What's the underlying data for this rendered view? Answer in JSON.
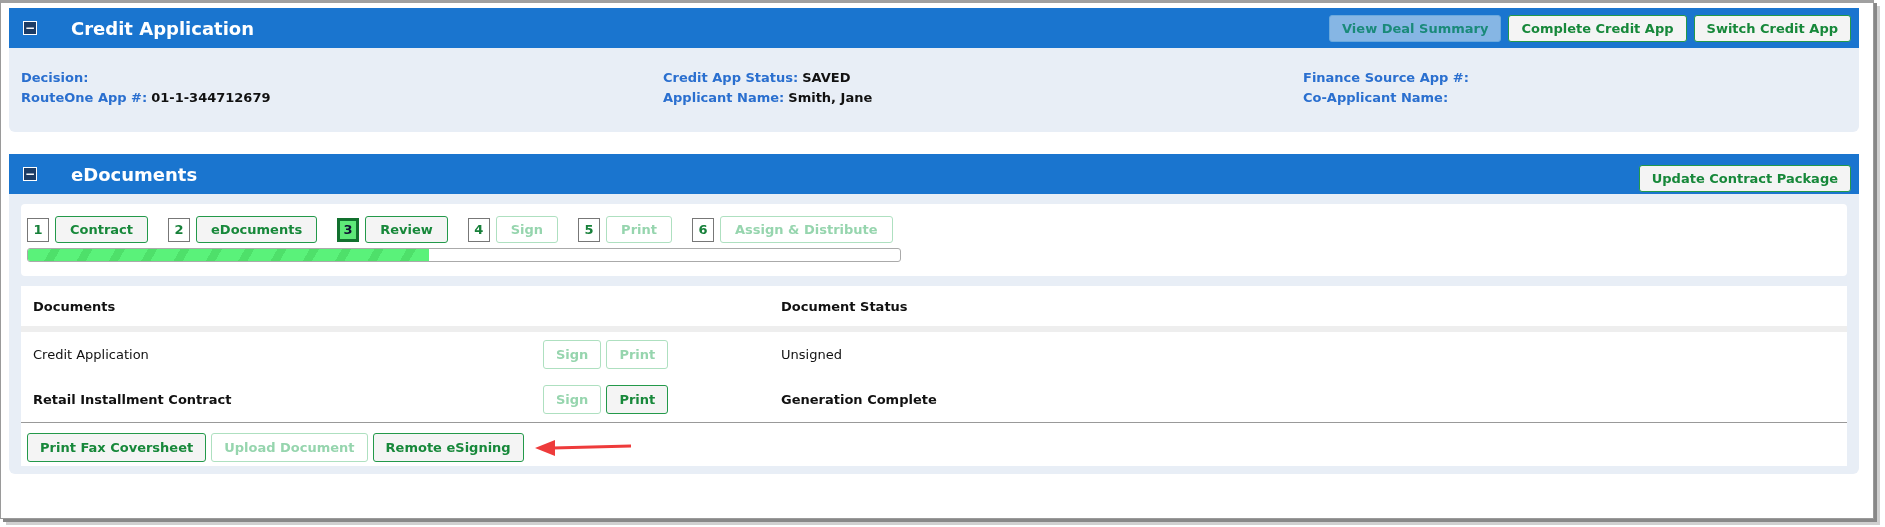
{
  "credit_panel": {
    "title": "Credit Application",
    "collapse_icon": "−",
    "buttons": [
      {
        "label": "View Deal Summary",
        "kind": "secondary"
      },
      {
        "label": "Complete Credit App",
        "kind": "primary"
      },
      {
        "label": "Switch Credit App",
        "kind": "primary"
      }
    ],
    "columns": [
      [
        {
          "label": "Decision:"
        },
        {
          "label": "RouteOne App #:",
          "value": "01-1-344712679"
        }
      ],
      [
        {
          "label": "Credit App Status:",
          "value": "SAVED"
        },
        {
          "label": "Applicant Name:",
          "value": "Smith, Jane"
        }
      ],
      [
        {
          "label": "Finance Source App #:"
        },
        {
          "label": "Co-Applicant Name:"
        }
      ]
    ]
  },
  "edocuments_panel": {
    "title": "eDocuments",
    "collapse_icon": "−",
    "buttons": [
      {
        "label": "Update Contract Package",
        "kind": "primary"
      }
    ],
    "steps": [
      {
        "number": "1",
        "label": "Contract",
        "selected": false,
        "disabled": false
      },
      {
        "number": "2",
        "label": "eDocuments",
        "selected": false,
        "disabled": false
      },
      {
        "number": "3",
        "label": "Review",
        "selected": true,
        "disabled": false
      },
      {
        "number": "4",
        "label": "Sign",
        "selected": false,
        "disabled": true
      },
      {
        "number": "5",
        "label": "Print",
        "selected": false,
        "disabled": true
      },
      {
        "number": "6",
        "label": "Assign & Distribute",
        "selected": false,
        "disabled": true
      }
    ],
    "progress": {
      "level": 0.46
    },
    "table": {
      "columns": [
        "Documents",
        "Document Status"
      ],
      "rows": [
        {
          "name": "Credit Application",
          "status": "Unsigned",
          "emphasized": false,
          "actions": [
            {
              "label": "Sign",
              "disabled": true
            },
            {
              "label": "Print",
              "disabled": true
            }
          ]
        },
        {
          "name": "Retail Installment Contract",
          "status": "Generation Complete",
          "emphasized": true,
          "actions": [
            {
              "label": "Sign",
              "disabled": true
            },
            {
              "label": "Print",
              "disabled": false
            }
          ]
        }
      ]
    },
    "footer_buttons": [
      {
        "label": "Print Fax Coversheet",
        "disabled": false
      },
      {
        "label": "Upload Document",
        "disabled": true
      },
      {
        "label": "Remote eSigning",
        "disabled": false
      }
    ],
    "annotation": {
      "kind": "arrow"
    }
  }
}
